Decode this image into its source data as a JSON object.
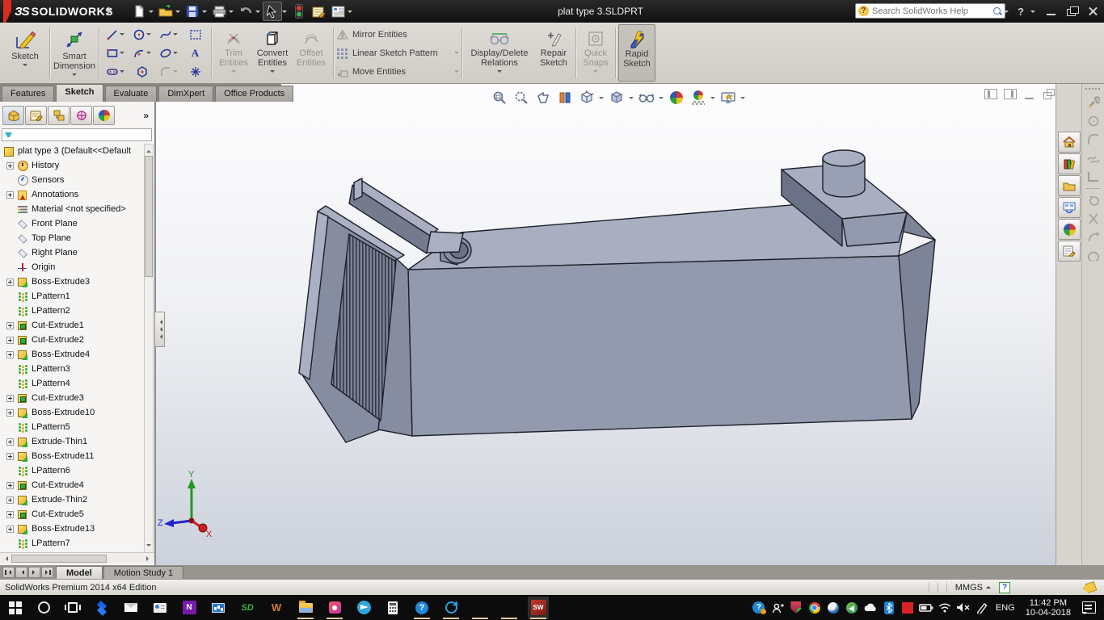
{
  "window": {
    "logo_mark": "ЗS",
    "logo_text": "SOLIDWORKS",
    "title": "plat type 3.SLDPRT",
    "search_placeholder": "Search SolidWorks Help"
  },
  "glyphs": {
    "help": "?",
    "text_tool": "A",
    "overflow": "»"
  },
  "ribbon": {
    "tabs": [
      {
        "name": "features",
        "label": "Features",
        "cls": ""
      },
      {
        "name": "sketch",
        "label": "Sketch",
        "cls": "active"
      },
      {
        "name": "evaluate",
        "label": "Evaluate",
        "cls": ""
      },
      {
        "name": "dimxpert",
        "label": "DimXpert",
        "cls": ""
      },
      {
        "name": "office-products",
        "label": "Office Products",
        "cls": ""
      }
    ],
    "sketch": "Sketch",
    "smart_dimension": "Smart Dimension",
    "trim_entities": "Trim Entities",
    "convert_entities": "Convert Entities",
    "offset_entities": "Offset Entities",
    "mirror_entities": "Mirror Entities",
    "linear_pattern": "Linear Sketch Pattern",
    "move_entities": "Move Entities",
    "display_delete_relations": "Display/Delete Relations",
    "repair_sketch": "Repair Sketch",
    "quick_snaps": "Quick Snaps",
    "rapid_sketch": "Rapid Sketch"
  },
  "feature_tree": {
    "root": "plat type 3  (Default<<Default",
    "items": [
      {
        "name": "history",
        "label": "History",
        "icon": "ic-history",
        "box": "plus"
      },
      {
        "name": "sensors",
        "label": "Sensors",
        "icon": "ic-sensors",
        "box": "none"
      },
      {
        "name": "annotations",
        "label": "Annotations",
        "icon": "ic-annot",
        "box": "plus"
      },
      {
        "name": "material",
        "label": "Material <not specified>",
        "icon": "ic-material",
        "box": "none"
      },
      {
        "name": "front-plane",
        "label": "Front Plane",
        "icon": "ic-plane",
        "box": "none"
      },
      {
        "name": "top-plane",
        "label": "Top Plane",
        "icon": "ic-plane",
        "box": "none"
      },
      {
        "name": "right-plane",
        "label": "Right Plane",
        "icon": "ic-plane",
        "box": "none"
      },
      {
        "name": "origin",
        "label": "Origin",
        "icon": "ic-origin",
        "box": "none"
      },
      {
        "name": "boss-extrude3",
        "label": "Boss-Extrude3",
        "icon": "ic-boss",
        "box": "plus"
      },
      {
        "name": "lpattern1",
        "label": "LPattern1",
        "icon": "ic-lpat",
        "box": "none"
      },
      {
        "name": "lpattern2",
        "label": "LPattern2",
        "icon": "ic-lpat",
        "box": "none"
      },
      {
        "name": "cut-extrude1",
        "label": "Cut-Extrude1",
        "icon": "ic-cut",
        "box": "plus"
      },
      {
        "name": "cut-extrude2",
        "label": "Cut-Extrude2",
        "icon": "ic-cut",
        "box": "plus"
      },
      {
        "name": "boss-extrude4",
        "label": "Boss-Extrude4",
        "icon": "ic-boss",
        "box": "plus"
      },
      {
        "name": "lpattern3",
        "label": "LPattern3",
        "icon": "ic-lpat",
        "box": "none"
      },
      {
        "name": "lpattern4",
        "label": "LPattern4",
        "icon": "ic-lpat",
        "box": "none"
      },
      {
        "name": "cut-extrude3",
        "label": "Cut-Extrude3",
        "icon": "ic-cut",
        "box": "plus"
      },
      {
        "name": "boss-extrude10",
        "label": "Boss-Extrude10",
        "icon": "ic-boss",
        "box": "plus"
      },
      {
        "name": "lpattern5",
        "label": "LPattern5",
        "icon": "ic-lpat",
        "box": "none"
      },
      {
        "name": "extrude-thin1",
        "label": "Extrude-Thin1",
        "icon": "ic-boss",
        "box": "plus"
      },
      {
        "name": "boss-extrude11",
        "label": "Boss-Extrude11",
        "icon": "ic-boss",
        "box": "plus"
      },
      {
        "name": "lpattern6",
        "label": "LPattern6",
        "icon": "ic-lpat",
        "box": "none"
      },
      {
        "name": "cut-extrude4",
        "label": "Cut-Extrude4",
        "icon": "ic-cut",
        "box": "plus"
      },
      {
        "name": "extrude-thin2",
        "label": "Extrude-Thin2",
        "icon": "ic-boss",
        "box": "plus"
      },
      {
        "name": "cut-extrude5",
        "label": "Cut-Extrude5",
        "icon": "ic-cut",
        "box": "plus"
      },
      {
        "name": "boss-extrude13",
        "label": "Boss-Extrude13",
        "icon": "ic-boss",
        "box": "plus"
      },
      {
        "name": "lpattern7",
        "label": "LPattern7",
        "icon": "ic-lpat",
        "box": "none"
      }
    ]
  },
  "model": {
    "colors": {
      "top": "#a9afc1",
      "front": "#939aad",
      "side": "#7e8498",
      "dark": "#6b7186",
      "light": "#aab0c2",
      "mid": "#878da1",
      "rail_front": "#757b8f",
      "cyl": "#9aa0b3"
    }
  },
  "triad": {
    "x": "X",
    "y": "Y",
    "z": "Z"
  },
  "model_tabs": [
    {
      "name": "model",
      "label": "Model",
      "cls": "active"
    },
    {
      "name": "motion-study-1",
      "label": "Motion Study 1",
      "cls": ""
    }
  ],
  "statusbar": {
    "edition": "SolidWorks Premium 2014 x64 Edition",
    "units": "MMGS"
  },
  "taskbar": {
    "lang": "ENG",
    "time": "11:42 PM",
    "date": "10-04-2018",
    "items": [
      {
        "name": "start",
        "cls": "tb-start",
        "glyph": ""
      },
      {
        "name": "cortana",
        "cls": "tb-cortana",
        "glyph": ""
      },
      {
        "name": "task-view",
        "cls": "tb-taskview",
        "glyph": ""
      },
      {
        "name": "dropbox",
        "cls": "tb-dropbox",
        "glyph": ""
      },
      {
        "name": "mail",
        "cls": "tb-mail",
        "glyph": ""
      },
      {
        "name": "people",
        "cls": "tb-people",
        "glyph": ""
      },
      {
        "name": "onenote",
        "cls": "tb-onenote",
        "glyph": "N"
      },
      {
        "name": "system-monitor",
        "cls": "tb-monitor",
        "glyph": ""
      },
      {
        "name": "sd-app",
        "cls": "tb-sd",
        "glyph": "SD"
      },
      {
        "name": "word",
        "cls": "tb-word",
        "glyph": "W"
      },
      {
        "name": "file-explorer",
        "cls": "tb-explorer running",
        "glyph": ""
      },
      {
        "name": "photos-app",
        "cls": "tb-photos running",
        "glyph": ""
      },
      {
        "name": "telegram",
        "cls": "tb-telegram",
        "glyph": ""
      },
      {
        "name": "calculator",
        "cls": "tb-calc",
        "glyph": ""
      },
      {
        "name": "help-app",
        "cls": "tb-help running",
        "glyph": "?"
      },
      {
        "name": "sync-app",
        "cls": "tb-sync running",
        "glyph": ""
      },
      {
        "name": "chrome",
        "cls": "tb-chrome running",
        "glyph": ""
      },
      {
        "name": "idm",
        "cls": "tb-idm running",
        "glyph": ""
      },
      {
        "name": "solidworks",
        "cls": "tb-sw running active",
        "glyph": "SW"
      }
    ]
  }
}
